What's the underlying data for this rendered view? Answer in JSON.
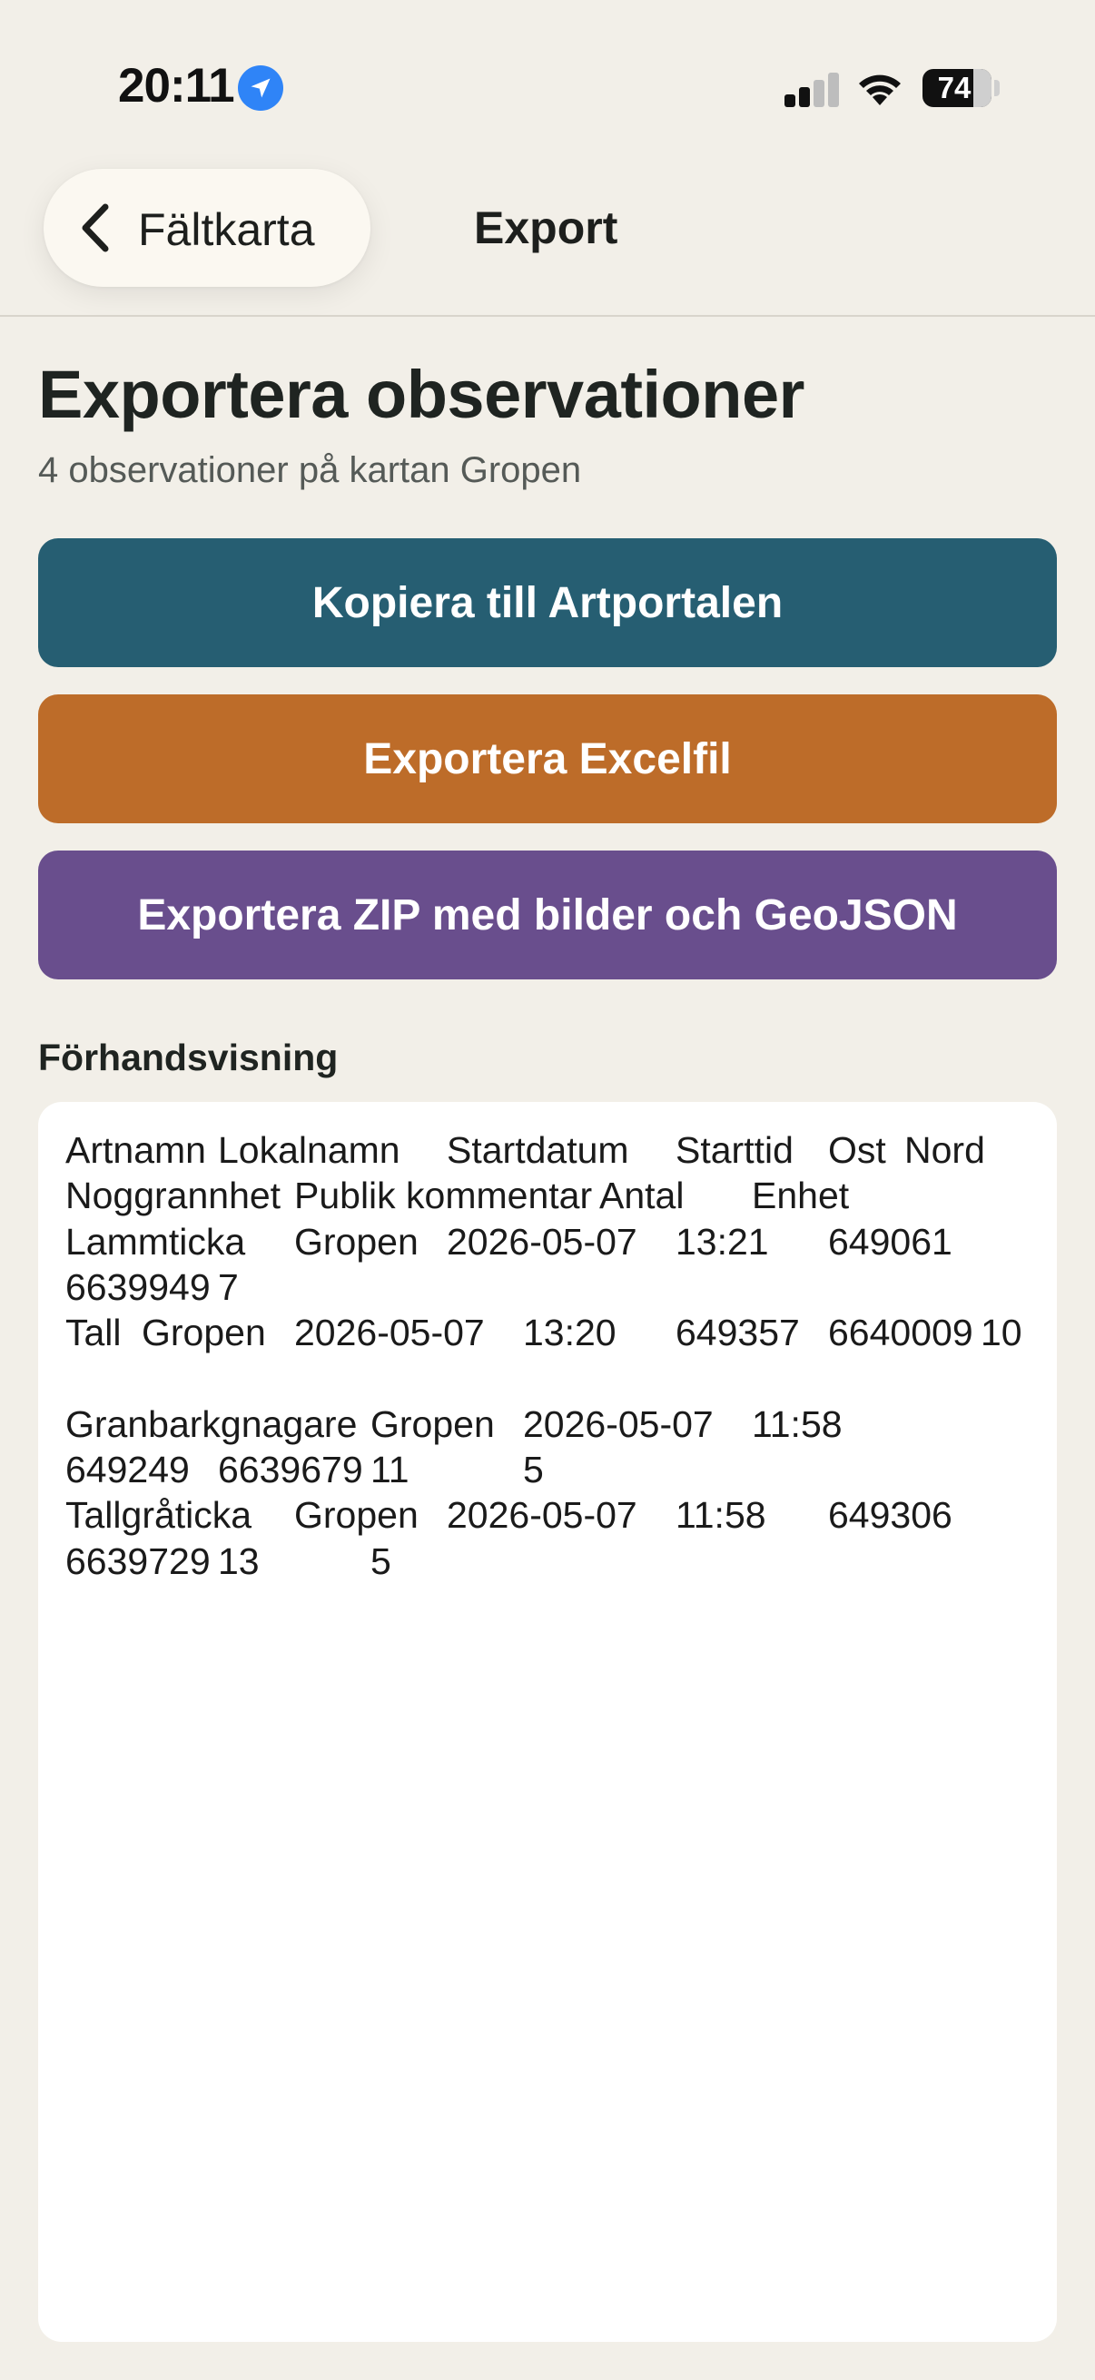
{
  "status_bar": {
    "time": "20:11",
    "battery": "74"
  },
  "nav": {
    "back_label": "Fältkarta",
    "title": "Export"
  },
  "main": {
    "title": "Exportera observationer",
    "subtitle": "4 observationer på kartan Gropen",
    "buttons": {
      "artportalen": "Kopiera till Artportalen",
      "excel": "Exportera Excelfil",
      "zip": "Exportera ZIP med bilder och GeoJSON"
    },
    "preview_label": "Förhandsvisning",
    "preview": {
      "headers": [
        "Artnamn",
        "Lokalnamn",
        "Startdatum",
        "Starttid",
        "Ost",
        "Nord",
        "Noggrannhet",
        "Publik kommentar",
        "Antal",
        "Enhet"
      ],
      "rows": [
        [
          "Lammticka",
          "Gropen",
          "2026-05-07",
          "13:21",
          "649061",
          "6639949",
          "7",
          "",
          "",
          ""
        ],
        [
          "Tall",
          "Gropen",
          "2026-05-07",
          "13:20",
          "649357",
          "6640009",
          "10",
          "",
          "",
          ""
        ],
        [
          "Granbarkgnagare",
          "Gropen",
          "2026-05-07",
          "11:58",
          "649249",
          "6639679",
          "11",
          "",
          "5",
          ""
        ],
        [
          "Tallgråticka",
          "Gropen",
          "2026-05-07",
          "11:58",
          "649306",
          "6639729",
          "13",
          "",
          "5",
          ""
        ]
      ]
    }
  },
  "colors": {
    "background": "#f2efe8",
    "artportalen_button": "#265e72",
    "excel_button": "#bd6c29",
    "zip_button": "#694e8d",
    "location_icon": "#2f84f7"
  }
}
